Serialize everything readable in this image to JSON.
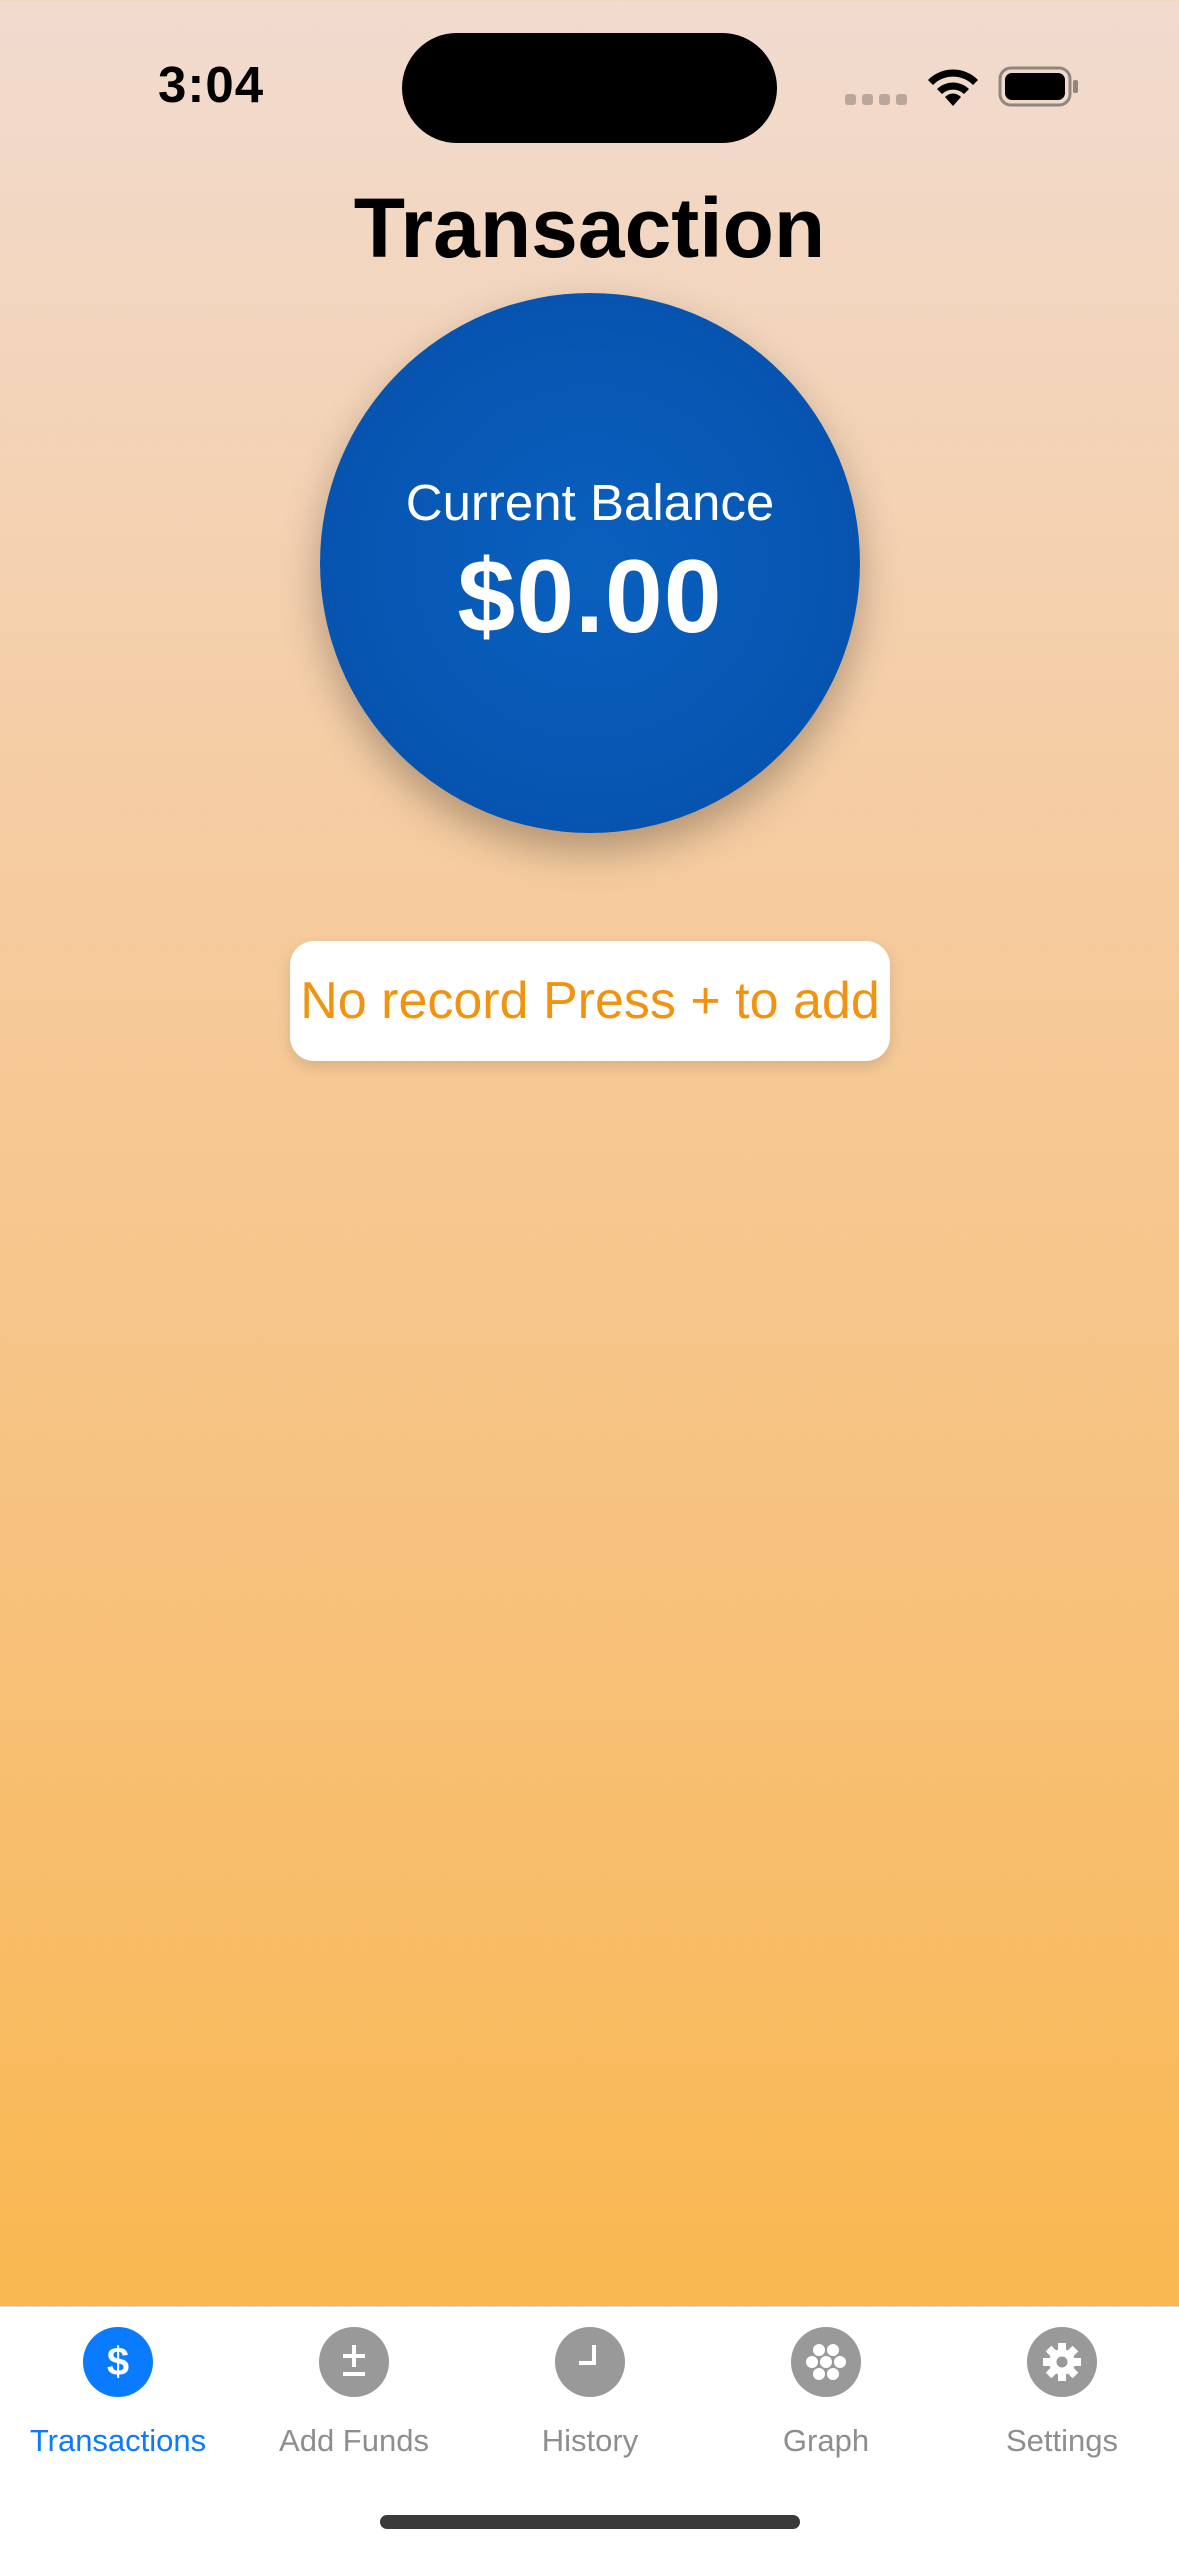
{
  "status_bar": {
    "time": "3:04"
  },
  "header": {
    "title": "Transaction"
  },
  "balance": {
    "label": "Current Balance",
    "amount": "$0.00",
    "color": "#0757b3"
  },
  "empty_state": {
    "message": "No record Press + to add",
    "color": "#f2930f"
  },
  "tab_bar": {
    "active_color": "#0a7aff",
    "inactive_color": "#999999",
    "tabs": [
      {
        "label": "Transactions",
        "icon": "dollar-icon",
        "active": true
      },
      {
        "label": "Add Funds",
        "icon": "plus-minus-icon",
        "active": false
      },
      {
        "label": "History",
        "icon": "clock-icon",
        "active": false
      },
      {
        "label": "Graph",
        "icon": "dots-icon",
        "active": false
      },
      {
        "label": "Settings",
        "icon": "gear-icon",
        "active": false
      }
    ]
  }
}
